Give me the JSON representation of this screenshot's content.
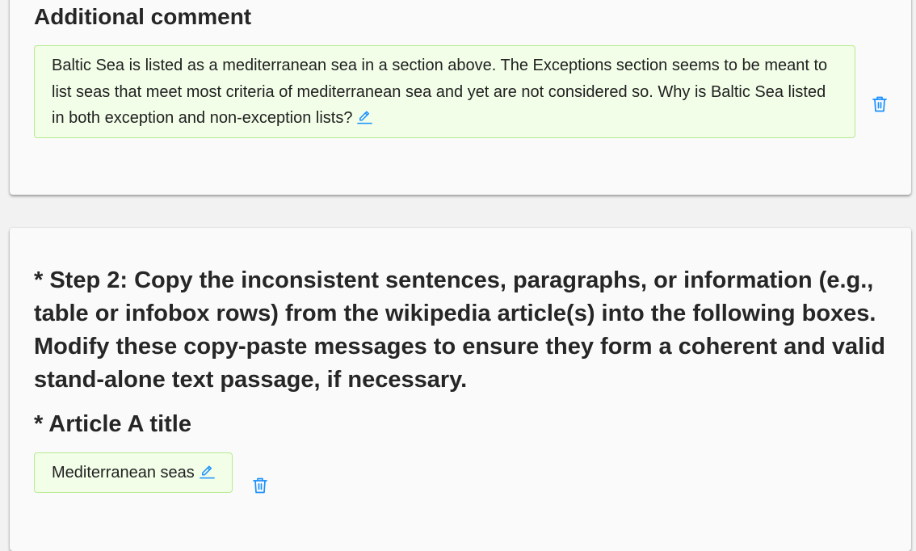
{
  "comment_section": {
    "heading": "Additional comment",
    "text": "Baltic Sea is listed as a mediterranean sea in a section above. The Exceptions section seems to be meant to list seas that meet most criteria of mediterranean sea and yet are not considered so. Why is Baltic Sea listed in both exception and non-exception lists?"
  },
  "step2": {
    "heading": "* Step 2: Copy the inconsistent sentences, paragraphs, or information (e.g., table or infobox rows) from the wikipedia article(s) into the following boxes. Modify these copy-paste messages to ensure they form a coherent and valid stand-alone text passage, if necessary.",
    "article_a_heading": "* Article A title",
    "article_a_value": "Mediterranean seas"
  },
  "colors": {
    "accent": "#1890ff",
    "box_background": "#f2fee8",
    "box_border": "#b7eb8f"
  },
  "icons": [
    "edit-icon",
    "trash-icon"
  ]
}
